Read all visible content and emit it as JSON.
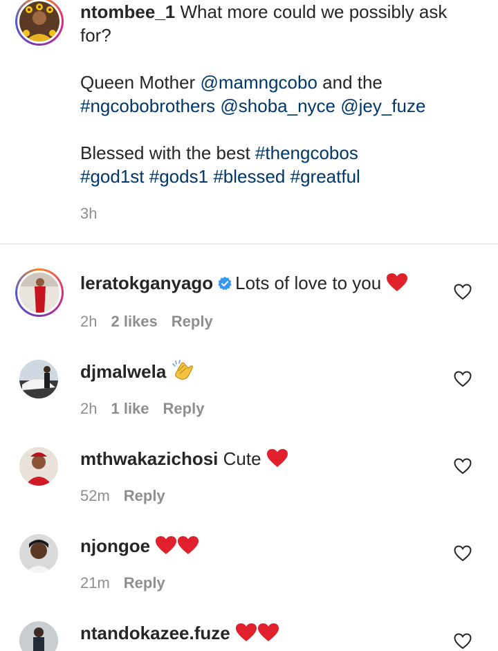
{
  "post": {
    "username": "ntombee_1",
    "caption_line1": "What more could we possibly ask for?",
    "caption_line2_prefix": "Queen Mother ",
    "mention1": "@mamngcobo",
    "caption_line2_mid": " and the",
    "hashtag1": "#ngcobobrothers",
    "mention2": "@shoba_nyce",
    "mention3": "@jey_fuze",
    "caption_line3_prefix": "Blessed with the best ",
    "hashtag2": "#thengcobos",
    "hashtag3": "#god1st",
    "hashtag4": "#gods1",
    "hashtag5": "#blessed",
    "hashtag6": "#greatful",
    "time": "3h"
  },
  "comments": [
    {
      "username": "leratokganyago",
      "verified": true,
      "text": "Lots of love to you",
      "emoji": "red-heart",
      "time": "2h",
      "likes": "2 likes",
      "reply": "Reply"
    },
    {
      "username": "djmalwela",
      "verified": false,
      "text": "",
      "emoji": "clapping-hands",
      "time": "2h",
      "likes": "1 like",
      "reply": "Reply"
    },
    {
      "username": "mthwakazichosi",
      "verified": false,
      "text": "Cute",
      "emoji": "red-heart",
      "time": "52m",
      "likes": "",
      "reply": "Reply"
    },
    {
      "username": "njongoe",
      "verified": false,
      "text": "",
      "emoji": "red-heart x2",
      "time": "21m",
      "likes": "",
      "reply": "Reply"
    },
    {
      "username": "ntandokazee.fuze",
      "verified": false,
      "text": "",
      "emoji": "red-heart x2",
      "time": "",
      "likes": "",
      "reply": ""
    }
  ],
  "colors": {
    "link": "#00376b",
    "meta": "#8e8e8e",
    "verified": "#3897f0",
    "heart": "#e0245e"
  }
}
